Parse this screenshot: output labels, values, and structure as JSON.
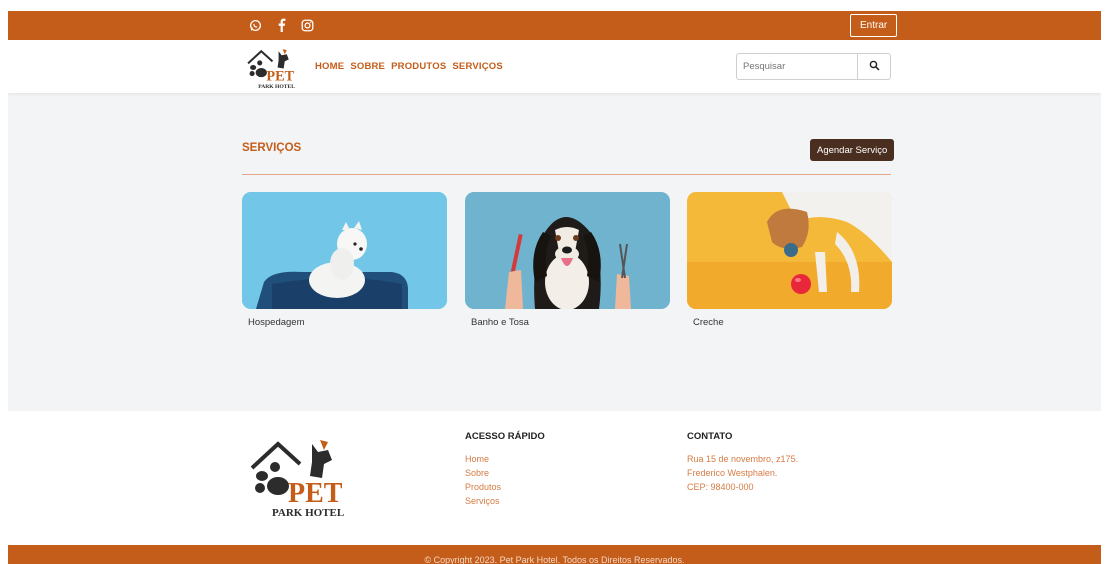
{
  "header": {
    "social": [
      "whatsapp-icon",
      "facebook-icon",
      "instagram-icon"
    ],
    "login_label": "Entrar"
  },
  "brand": {
    "logo_main": "PET",
    "logo_sub": "PARK HOTEL"
  },
  "nav": {
    "items": [
      "HOME",
      "SOBRE",
      "PRODUTOS",
      "SERVIÇOS"
    ]
  },
  "search": {
    "placeholder": "Pesquisar"
  },
  "services": {
    "title": "SERVIÇOS",
    "cta_label": "Agendar Serviço",
    "cards": [
      {
        "label": "Hospedagem"
      },
      {
        "label": "Banho e Tosa"
      },
      {
        "label": "Creche"
      }
    ]
  },
  "footer": {
    "quick_title": "ACESSO RÁPIDO",
    "quick_links": [
      "Home",
      "Sobre",
      "Produtos",
      "Serviços"
    ],
    "contact_title": "CONTATO",
    "contact_lines": [
      "Rua 15 de novembro, z175.",
      "Frederico Westphalen.",
      "CEP: 98400-000"
    ],
    "copyright": "© Copyright 2023. Pet Park Hotel. Todos os Direitos Reservados."
  },
  "colors": {
    "brand": "#c55d1a",
    "dark_button": "#4a2f20",
    "page_bg": "#f3f4f6"
  }
}
